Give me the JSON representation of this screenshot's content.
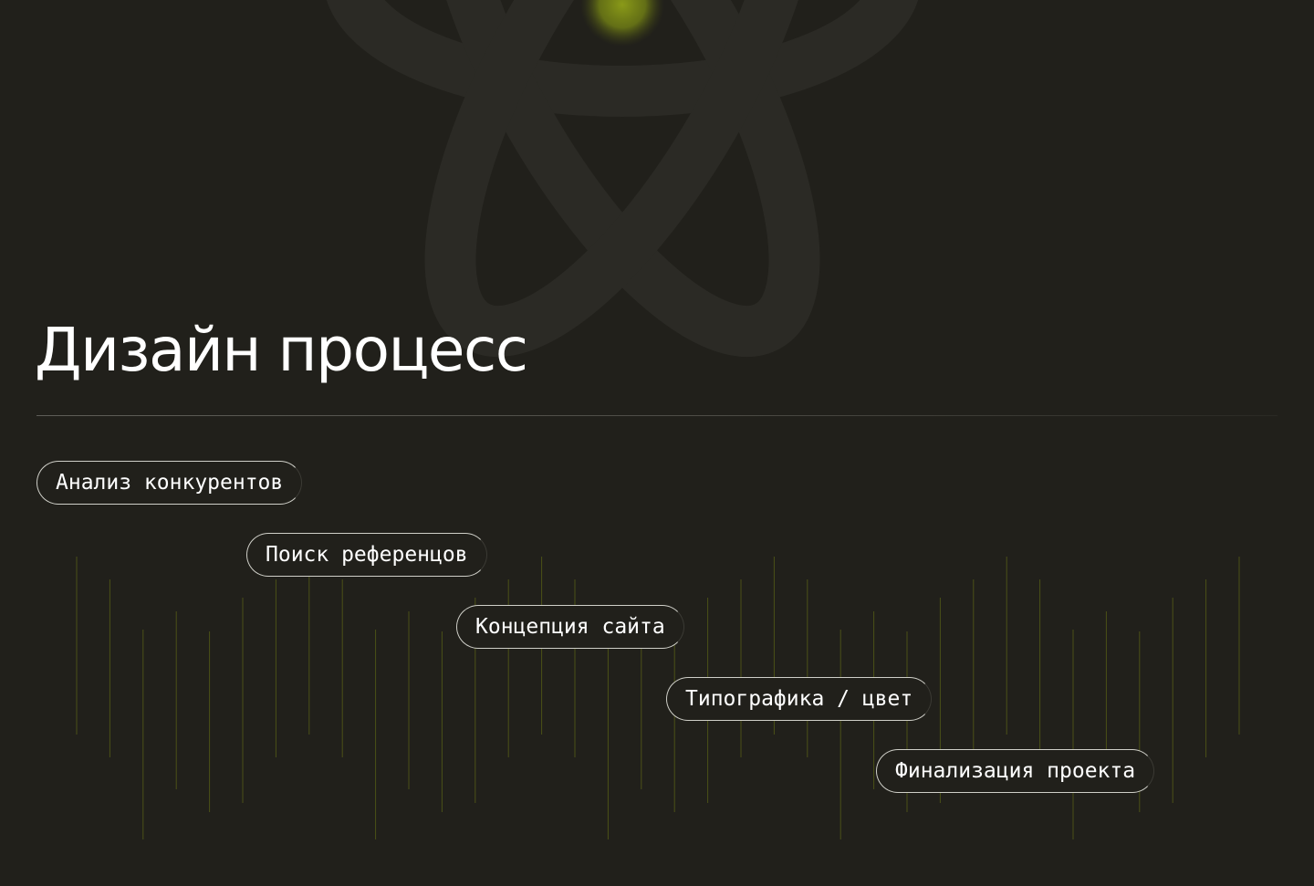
{
  "page": {
    "title": "Дизайн процесс"
  },
  "steps": [
    {
      "label": "Анализ конкурентов"
    },
    {
      "label": "Поиск референцов"
    },
    {
      "label": "Концепция сайта"
    },
    {
      "label": "Типографика / цвет"
    },
    {
      "label": "Финализация проекта"
    }
  ],
  "colors": {
    "background": "#21201b",
    "atom_stroke": "#2b2a25",
    "glow": "#8a9a18",
    "line_accent": "#6f7a14",
    "pill_border": "#cfcfc8",
    "text": "#ffffff"
  },
  "icons": {
    "decoration": "atom-icon"
  }
}
